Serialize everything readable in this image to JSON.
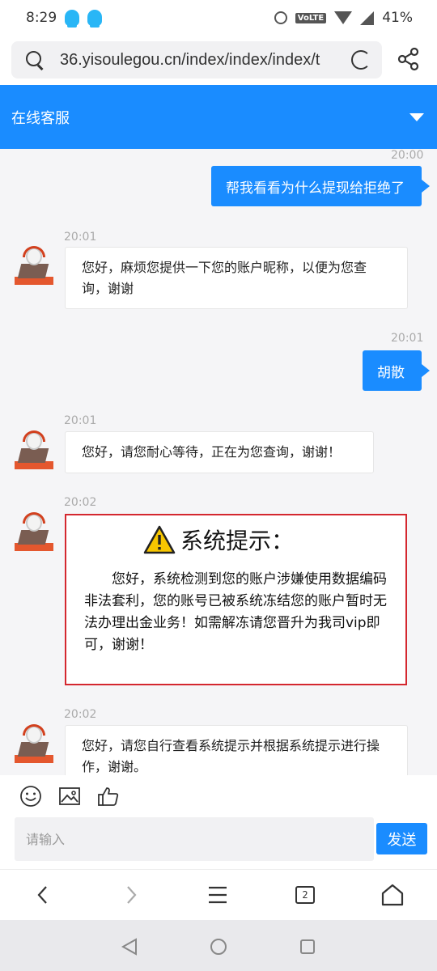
{
  "status_bar": {
    "time": "8:29",
    "volte": "VoLTE",
    "battery": "41%"
  },
  "browser": {
    "url": "36.yisoulegou.cn/index/index/index/t",
    "tab_count": "2"
  },
  "header": {
    "title": "在线客服"
  },
  "messages": [
    {
      "from": "user",
      "time": "20:00",
      "text": "帮我看看为什么提现给拒绝了"
    },
    {
      "from": "agent",
      "time": "20:01",
      "text": "您好，麻烦您提供一下您的账户昵称，以便为您查询，谢谢"
    },
    {
      "from": "user",
      "time": "20:01",
      "text": "胡散"
    },
    {
      "from": "agent",
      "time": "20:01",
      "text": "您好，请您耐心等待，正在为您查询，谢谢！"
    },
    {
      "from": "agent",
      "time": "20:02",
      "type": "notice",
      "title": "系统提示：",
      "text": "您好，系统检测到您的账户涉嫌使用数据编码非法套利，您的账号已被系统冻结您的账户暂时无法办理出金业务！如需解冻请您晋升为我司vip即可，谢谢！"
    },
    {
      "from": "agent",
      "time": "20:02",
      "text": "您好，请您自行查看系统提示并根据系统提示进行操作，谢谢。"
    }
  ],
  "composer": {
    "placeholder": "请输入",
    "send_label": "发送"
  },
  "icons": {
    "toolbar": [
      "emoji-icon",
      "image-icon",
      "thumbs-up-icon"
    ],
    "browser_nav": [
      "back-icon",
      "forward-icon",
      "menu-icon",
      "tabs-icon",
      "home-icon"
    ],
    "system_nav": [
      "back-triangle-icon",
      "home-circle-icon",
      "recents-square-icon"
    ]
  },
  "colors": {
    "accent": "#1a8cff",
    "notice_border": "#d4272f",
    "warning": "#f7c600"
  }
}
